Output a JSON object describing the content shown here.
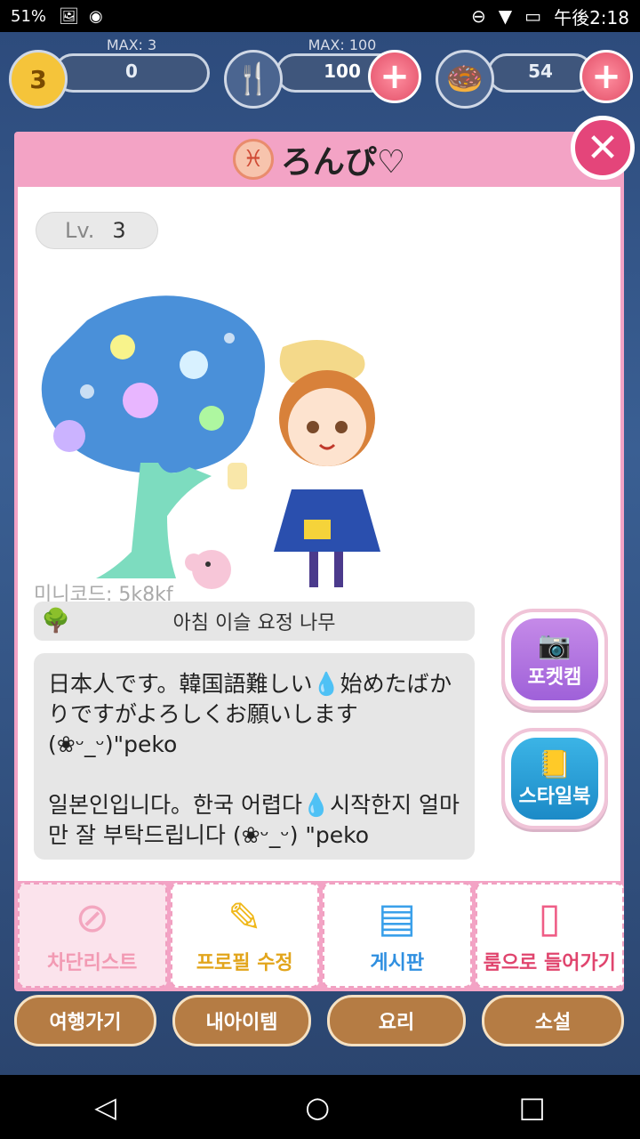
{
  "status_bar": {
    "battery_small": "51%",
    "time": "午後2:18"
  },
  "top_stats": {
    "stars": {
      "max_label": "MAX: 3",
      "value": "0",
      "level_badge": "3"
    },
    "food": {
      "max_label": "MAX: 100",
      "value": "100"
    },
    "donut": {
      "value": "54"
    }
  },
  "bottom_nav": [
    "여행가기",
    "내아이템",
    "요리",
    "소설"
  ],
  "profile": {
    "name": "ろんぴ♡",
    "level_prefix": "Lv.",
    "level": "3",
    "minicode": "미니코드: 5k8kf",
    "item_label": "아침 이슬 요정 나무",
    "bio": "日本人です。韓国語難しい💧始めたばかりですがよろしくお願いします(❀ᵕ_ᵕ)\"peko\n\n일본인입니다。한국 어렵다💧시작한지 얼마 만 잘 부탁드립니다 (❀ᵕ_ᵕ) \"peko"
  },
  "side_buttons": {
    "pocket_cam": "포켓캠",
    "style_book": "스타일북"
  },
  "actions": [
    {
      "label": "차단리스트",
      "color": "#f29ab3"
    },
    {
      "label": "프로필 수정",
      "color": "#e2a51c"
    },
    {
      "label": "게시판",
      "color": "#2f8fe0"
    },
    {
      "label": "룸으로 들어가기",
      "color": "#e0456e"
    }
  ]
}
